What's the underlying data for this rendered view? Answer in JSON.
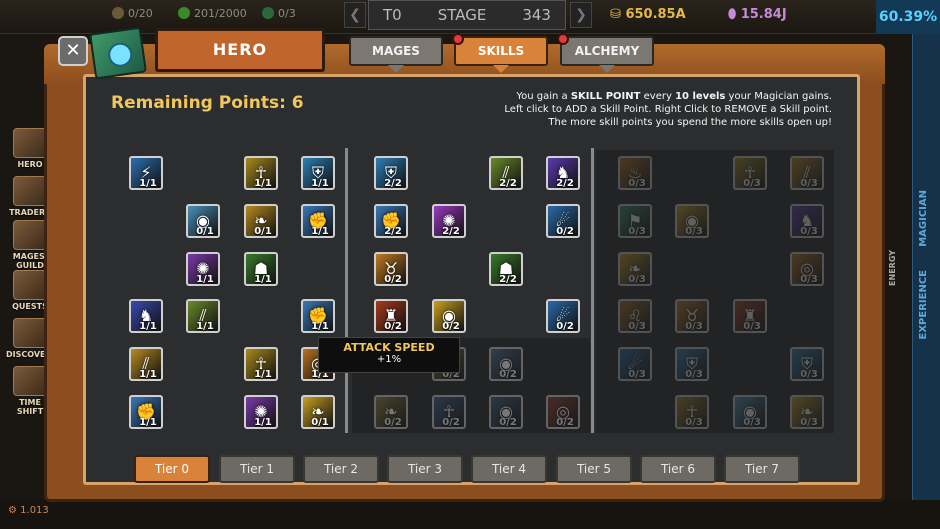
{
  "hud": {
    "res1": "0/20",
    "res2": "201/2000",
    "res3": "0/3",
    "stage_left": "T0",
    "stage_label": "STAGE",
    "stage_value": "343",
    "gold": "650.85A",
    "mana": "15.84J",
    "percent": "60.39%",
    "bottom_value": "1.013"
  },
  "side_menu": [
    "HERO",
    "TRADERS",
    "MAGES' GUILD",
    "QUESTS",
    "DISCOVERY",
    "TIME SHIFT"
  ],
  "right_labels": {
    "top": "MAGICIAN",
    "bottom": "EXPERIENCE",
    "energy": "ENERGY"
  },
  "panel": {
    "hero_label": "HERO",
    "tabs": {
      "mages": "MAGES",
      "skills": "SKILLS",
      "alchemy": "ALCHEMY"
    },
    "remaining": "Remaining Points: 6",
    "info": {
      "l1a": "You gain a ",
      "l1b": "SKILL POINT",
      "l1c": " every ",
      "l1d": "10 levels",
      "l1e": " your Magician gains.",
      "l2": "Left click to ADD a Skill Point. Right Click to REMOVE a Skill point.",
      "l3": "The more skill points you spend the more skills open up!"
    },
    "tooltip": {
      "title": "ATTACK SPEED",
      "value": "+1%"
    },
    "tiers": [
      "Tier 0",
      "Tier 1",
      "Tier 2",
      "Tier 3",
      "Tier 4",
      "Tier 5",
      "Tier 6",
      "Tier 7"
    ],
    "active_tier": 0
  },
  "skills": [
    {
      "count": "1/1",
      "icon": "lightning",
      "color": "#2d6fb0",
      "state": "on"
    },
    {
      "count": "1/1",
      "icon": "figure",
      "color": "#a88a1c",
      "state": "on"
    },
    {
      "count": "1/1",
      "icon": "shield",
      "color": "#2c7fb6",
      "state": "on"
    },
    {
      "count": "0/1",
      "icon": "orb",
      "color": "#4a8fb8",
      "state": "on"
    },
    {
      "count": "0/1",
      "icon": "wing",
      "color": "#b88a20",
      "state": "on"
    },
    {
      "count": "1/1",
      "icon": "fist",
      "color": "#3a78b8",
      "state": "on"
    },
    {
      "count": "1/1",
      "icon": "aura",
      "color": "#7a3aa8",
      "state": "on"
    },
    {
      "count": "1/1",
      "icon": "cauldron",
      "color": "#3a7a2a",
      "state": "on"
    },
    {
      "count": "1/1",
      "icon": "dragon",
      "color": "#3a4ab0",
      "state": "on"
    },
    {
      "count": "1/1",
      "icon": "claw",
      "color": "#6a8a2a",
      "state": "on"
    },
    {
      "count": "1/1",
      "icon": "fist",
      "color": "#3a78b8",
      "state": "on"
    },
    {
      "count": "1/1",
      "icon": "claw",
      "color": "#b88a20",
      "state": "on"
    },
    {
      "count": "1/1",
      "icon": "figure",
      "color": "#a88a1c",
      "state": "on"
    },
    {
      "count": "1/1",
      "icon": "target",
      "color": "#b8701c",
      "state": "on"
    },
    {
      "count": "1/1",
      "icon": "fist",
      "color": "#3a78b8",
      "state": "on"
    },
    {
      "count": "1/1",
      "icon": "aura",
      "color": "#7a3aa8",
      "state": "on"
    },
    {
      "count": "0/1",
      "icon": "wing",
      "color": "#c8a020",
      "state": "on"
    },
    {
      "count": "2/2",
      "icon": "shield",
      "color": "#2c7fb6",
      "state": "on"
    },
    {
      "count": "2/2",
      "icon": "claw",
      "color": "#6a8a2a",
      "state": "on"
    },
    {
      "count": "2/2",
      "icon": "dragon",
      "color": "#5a3ab0",
      "state": "on"
    },
    {
      "count": "2/2",
      "icon": "fist",
      "color": "#3a78b8",
      "state": "on"
    },
    {
      "count": "2/2",
      "icon": "aura",
      "color": "#9a3ac0",
      "state": "on"
    },
    {
      "count": "0/2",
      "icon": "comet",
      "color": "#2a6aa8",
      "state": "on"
    },
    {
      "count": "0/2",
      "icon": "fox",
      "color": "#c07a20",
      "state": "on"
    },
    {
      "count": "2/2",
      "icon": "cauldron",
      "color": "#3a7a2a",
      "state": "on"
    },
    {
      "count": "0/2",
      "icon": "runner",
      "color": "#a83a1c",
      "state": "on"
    },
    {
      "count": "0/2",
      "icon": "eye",
      "color": "#c8a020",
      "state": "on"
    },
    {
      "count": "0/2",
      "icon": "comet",
      "color": "#2a6aa8",
      "state": "on"
    },
    {
      "count": "0/2",
      "icon": "lion",
      "color": "#7a6a3a",
      "state": "dim"
    },
    {
      "count": "0/2",
      "icon": "orb",
      "color": "#4a6a8a",
      "state": "dim"
    },
    {
      "count": "0/2",
      "icon": "wing",
      "color": "#8a7a3a",
      "state": "dim"
    },
    {
      "count": "0/2",
      "icon": "figure",
      "color": "#3a5a8a",
      "state": "dim"
    },
    {
      "count": "0/2",
      "icon": "orb",
      "color": "#3a5a7a",
      "state": "dim"
    },
    {
      "count": "0/2",
      "icon": "target",
      "color": "#8a3a2a",
      "state": "dim"
    },
    {
      "count": "0/3",
      "icon": "flame",
      "color": "#b8701c",
      "state": "locked"
    },
    {
      "count": "0/3",
      "icon": "figure",
      "color": "#a88a1c",
      "state": "locked"
    },
    {
      "count": "0/3",
      "icon": "claw",
      "color": "#b88a20",
      "state": "locked"
    },
    {
      "count": "0/3",
      "icon": "flag",
      "color": "#3a8a6a",
      "state": "locked"
    },
    {
      "count": "0/3",
      "icon": "eye",
      "color": "#c8a020",
      "state": "locked"
    },
    {
      "count": "0/3",
      "icon": "dragon",
      "color": "#5a3ab0",
      "state": "locked"
    },
    {
      "count": "0/3",
      "icon": "wing",
      "color": "#c8a020",
      "state": "locked"
    },
    {
      "count": "0/3",
      "icon": "target",
      "color": "#b8701c",
      "state": "locked"
    },
    {
      "count": "0/3",
      "icon": "lion",
      "color": "#a8701c",
      "state": "locked"
    },
    {
      "count": "0/3",
      "icon": "fox",
      "color": "#c07a20",
      "state": "locked"
    },
    {
      "count": "0/3",
      "icon": "runner",
      "color": "#a83a1c",
      "state": "locked"
    },
    {
      "count": "0/3",
      "icon": "comet",
      "color": "#2a6aa8",
      "state": "locked"
    },
    {
      "count": "0/3",
      "icon": "shield",
      "color": "#2c7fb6",
      "state": "locked"
    },
    {
      "count": "0/3",
      "icon": "shield",
      "color": "#2c7fb6",
      "state": "locked"
    },
    {
      "count": "0/3",
      "icon": "figure",
      "color": "#a88a1c",
      "state": "locked"
    },
    {
      "count": "0/3",
      "icon": "orb",
      "color": "#4a8fb8",
      "state": "locked"
    },
    {
      "count": "0/3",
      "icon": "wing",
      "color": "#c8a020",
      "state": "locked"
    }
  ],
  "icon_glyphs": {
    "lightning": "⚡",
    "figure": "☥",
    "shield": "⛨",
    "orb": "◉",
    "wing": "❧",
    "fist": "✊",
    "aura": "✺",
    "cauldron": "☗",
    "dragon": "♞",
    "claw": "⫽",
    "target": "◎",
    "comet": "☄",
    "fox": "♉",
    "runner": "♜",
    "eye": "◉",
    "lion": "♌",
    "flame": "♨",
    "flag": "⚑"
  }
}
